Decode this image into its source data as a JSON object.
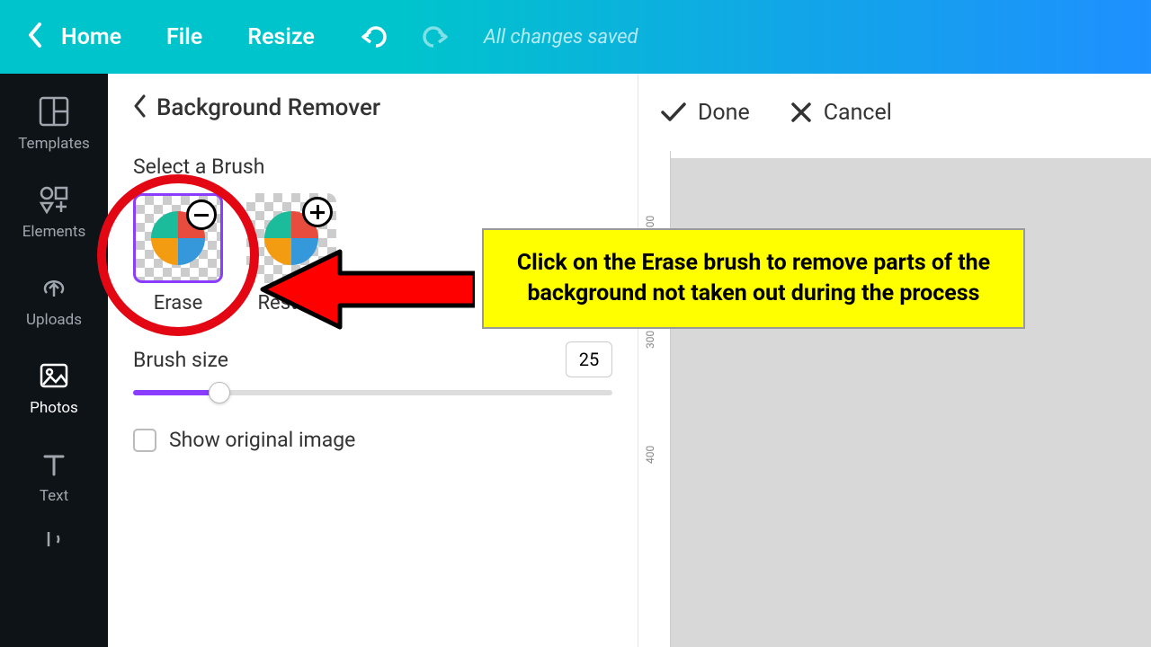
{
  "topbar": {
    "home": "Home",
    "file": "File",
    "resize": "Resize",
    "status": "All changes saved"
  },
  "sidebar": {
    "templates": "Templates",
    "elements": "Elements",
    "uploads": "Uploads",
    "photos": "Photos",
    "text": "Text"
  },
  "panel": {
    "title": "Background Remover",
    "select_brush": "Select a Brush",
    "erase": "Erase",
    "restore": "Restore",
    "brush_size_label": "Brush size",
    "brush_size_value": "25",
    "show_original": "Show original image"
  },
  "actions": {
    "done": "Done",
    "cancel": "Cancel"
  },
  "ruler": {
    "t200": "200",
    "t300": "300",
    "t400": "400"
  },
  "annotation": {
    "text": "Click on the Erase brush to remove parts of the background not taken out during the process"
  }
}
